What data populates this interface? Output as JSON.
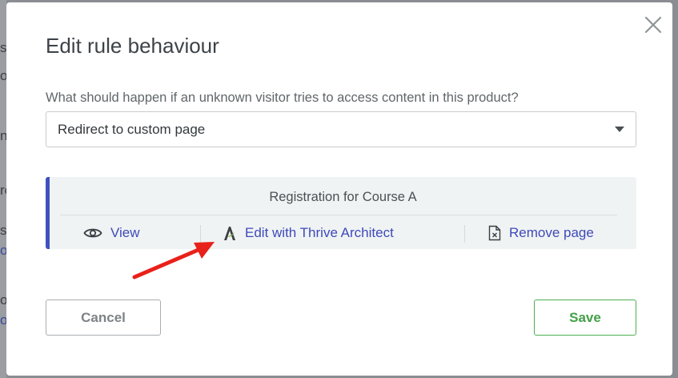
{
  "dialog": {
    "title": "Edit rule behaviour",
    "question": "What should happen if an unknown visitor tries to access content in this product?",
    "select": {
      "selected": "Redirect to custom page"
    },
    "page_card": {
      "name": "Registration for Course A",
      "actions": {
        "view": "View",
        "edit": "Edit with Thrive Architect",
        "remove": "Remove page"
      }
    },
    "buttons": {
      "cancel": "Cancel",
      "save": "Save"
    }
  },
  "background": {
    "fragments": [
      "s",
      "o",
      "na",
      "ro",
      "s",
      "o",
      "o",
      "o"
    ]
  },
  "colors": {
    "accent": "#3f51c0",
    "link": "#3e4ab8",
    "save_green": "#43a047",
    "annotation_arrow": "#e8211a"
  },
  "icons": [
    "close-icon",
    "eye-icon",
    "thrive-architect-icon",
    "file-remove-icon",
    "annotation-arrow"
  ]
}
